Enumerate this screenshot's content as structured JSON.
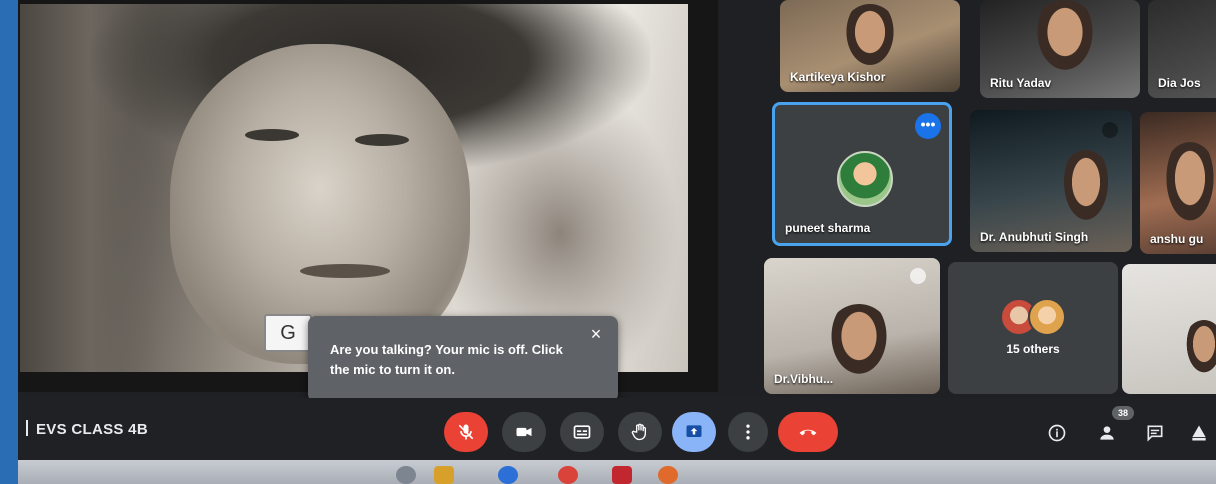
{
  "meeting": {
    "title": "EVS CLASS 4B"
  },
  "presentation": {
    "visible_caption_fragment": "G"
  },
  "participants": [
    {
      "name": "Kartikeya Kishor"
    },
    {
      "name": "Ritu Yadav"
    },
    {
      "name": "Dia Jos"
    },
    {
      "name": "puneet sharma",
      "active": true
    },
    {
      "name": "Dr. Anubhuti Singh"
    },
    {
      "name": "anshu gu"
    },
    {
      "name": "Dr.Vibhu..."
    },
    {
      "name": "15 others"
    }
  ],
  "tooltip": {
    "message": "Are you talking? Your mic is off. Click the mic to turn it on.",
    "close_glyph": "×"
  },
  "controls": {
    "more_glyph": "•••",
    "people_count": "38"
  },
  "colors": {
    "leave_red": "#ea4335",
    "mic_off_red": "#ea4335",
    "present_blue": "#8ab4f8",
    "active_border": "#4aa3ef",
    "bar_bg": "#202124"
  },
  "icons": {
    "mic": "mic-off-icon",
    "camera": "camera-icon",
    "captions": "captions-icon",
    "hand": "raise-hand-icon",
    "present": "present-screen-icon",
    "more": "more-vert-icon",
    "leave": "hang-up-icon",
    "info": "info-icon",
    "people": "people-icon",
    "chat": "chat-icon",
    "activities": "activities-icon"
  }
}
